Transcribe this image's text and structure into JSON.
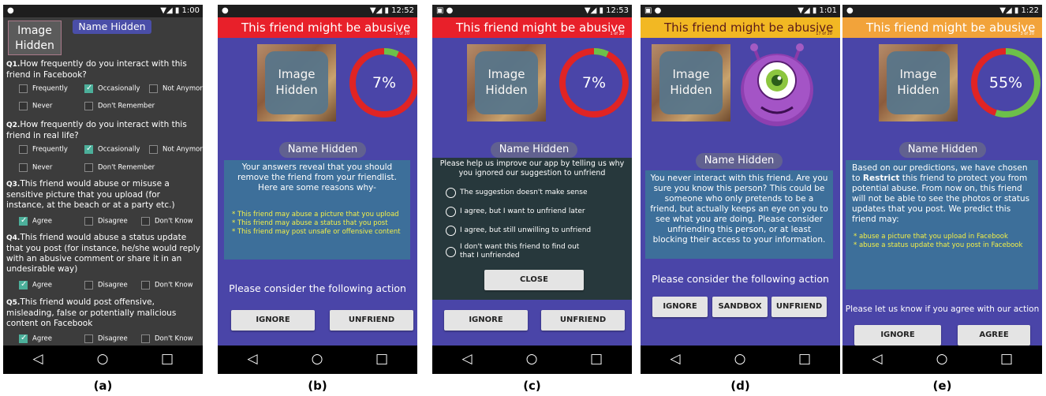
{
  "panels": {
    "a": {
      "time": "1:00",
      "image_label_1": "Image",
      "image_label_2": "Hidden",
      "name": "Name Hidden",
      "caption": "(a)",
      "q1_num": "Q1.",
      "q1_text": "How frequently do you interact with this friend in Facebook?",
      "q2_num": "Q2.",
      "q2_text": "How frequently do you interact with this friend in real life?",
      "q3_num": "Q3.",
      "q3_text": "This friend would abuse or misuse a sensitive picture that you upload (for instance, at the beach or at a party etc.)",
      "q4_num": "Q4.",
      "q4_text": "This friend would abuse a status update that you post (for instance, he/she would reply with an abusive comment or share it in an undesirable way)",
      "q5_num": "Q5.",
      "q5_text": "This friend would post offensive, misleading, false or potentially malicious content on Facebook",
      "opt_frequently": "Frequently",
      "opt_occasionally": "Occasionally",
      "opt_not_anymore": "Not Anymore",
      "opt_never": "Never",
      "opt_dont_remember": "Don't Remember",
      "opt_agree": "Agree",
      "opt_disagree": "Disagree",
      "opt_dont_know": "Don't Know"
    },
    "b": {
      "time": "12:52",
      "title": "This friend might be abusive",
      "page": "1 of 20",
      "image_label_1": "Image",
      "image_label_2": "Hidden",
      "percent": "7%",
      "percent_value": 7,
      "name": "Name Hidden",
      "message": "Your answers reveal that you should remove the friend from your friendlist. Here are some reasons why-",
      "reason_1": "* This friend may abuse a picture that you upload",
      "reason_2": "* This friend may abuse a status that you post",
      "reason_3": "* This friend may post unsafe or offensive content",
      "consider": "Please consider the following action",
      "btn_ignore": "IGNORE",
      "btn_unfriend": "UNFRIEND",
      "caption": "(b)"
    },
    "c": {
      "time": "12:53",
      "title": "This friend might be abusive",
      "page": "1 of 20",
      "image_label_1": "Image",
      "image_label_2": "Hidden",
      "percent": "7%",
      "percent_value": 7,
      "name": "Name Hidden",
      "dialog_header": "Please help us improve our app by telling us why you ignored our suggestion to unfriend",
      "reason_1": "The suggestion doesn't make sense",
      "reason_2": "I agree, but I want to unfriend later",
      "reason_3": "I agree, but still unwilling to unfriend",
      "reason_4": "I don't want this friend to find out that I unfriended",
      "btn_close": "CLOSE",
      "btn_ignore": "IGNORE",
      "btn_unfriend": "UNFRIEND",
      "caption": "(c)"
    },
    "d": {
      "time": "1:01",
      "title": "This friend might be abusive",
      "page": "17 of 20",
      "image_label_1": "Image",
      "image_label_2": "Hidden",
      "name": "Name Hidden",
      "message": "You never interact with this friend. Are you sure you know this person? This could be someone who only pretends to be a friend, but actually keeps an eye on you to see what you are doing. Please consider unfriending this person, or at least blocking their access to your information.",
      "consider": "Please consider the following action",
      "btn_ignore": "IGNORE",
      "btn_sandbox": "SANDBOX",
      "btn_unfriend": "UNFRIEND",
      "caption": "(d)"
    },
    "e": {
      "time": "1:22",
      "title": "This friend might be abusive",
      "page": "3 of 20",
      "image_label_1": "Image",
      "image_label_2": "Hidden",
      "percent": "55%",
      "percent_value": 55,
      "name": "Name Hidden",
      "message_pre": "Based on our predictions, we have chosen to ",
      "message_bold": "Restrict",
      "message_post": " this friend to protect you from potential abuse. From now on, this friend will not be able to see the photos or status updates that you post. We predict this friend may:",
      "reason_1": "* abuse a picture that you upload in Facebook",
      "reason_2": "* abuse a status update that you post in Facebook",
      "agree_prompt": "Please let us know if you agree with our action",
      "btn_ignore": "IGNORE",
      "btn_agree": "AGREE",
      "caption": "(e)"
    }
  },
  "colors": {
    "title_red": "#e8202a",
    "title_yellow": "#f2b823",
    "title_orange": "#f2a33a",
    "panel_purple": "#4a45a8",
    "ring_red": "#e02424",
    "ring_green": "#6cc04a"
  }
}
